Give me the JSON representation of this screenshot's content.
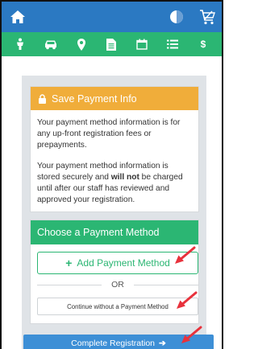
{
  "header": {
    "home_icon": "home-icon",
    "theme_icon": "half-circle-icon",
    "cart_icon": "cart-icon"
  },
  "nav_icons": [
    "person-icon",
    "car-icon",
    "map-pin-icon",
    "document-icon",
    "calendar-icon",
    "list-icon",
    "dollar-icon"
  ],
  "nav_glyphs": {
    "dollar": "$"
  },
  "save_card": {
    "title": "Save Payment Info",
    "para1": "Your payment method information is for any up-front registration fees or prepayments.",
    "para2_a": "Your payment method information is stored securely and ",
    "para2_bold": "will not",
    "para2_b": " be charged until after our staff has reviewed and approved your registration."
  },
  "choose_card": {
    "title": "Choose a Payment Method",
    "add_label": "Add Payment Method",
    "add_plus": "+",
    "or_label": "OR",
    "continue_label": "Continue without a Payment Method"
  },
  "complete_button": {
    "label": "Complete Registration",
    "arrow": "➔"
  },
  "colors": {
    "topbar": "#2b79c2",
    "navbar": "#2bb673",
    "save_header": "#f0ad3a",
    "choose_header": "#2bb673",
    "complete_button": "#3d8fd6",
    "annotation_arrow": "#e8323c"
  }
}
